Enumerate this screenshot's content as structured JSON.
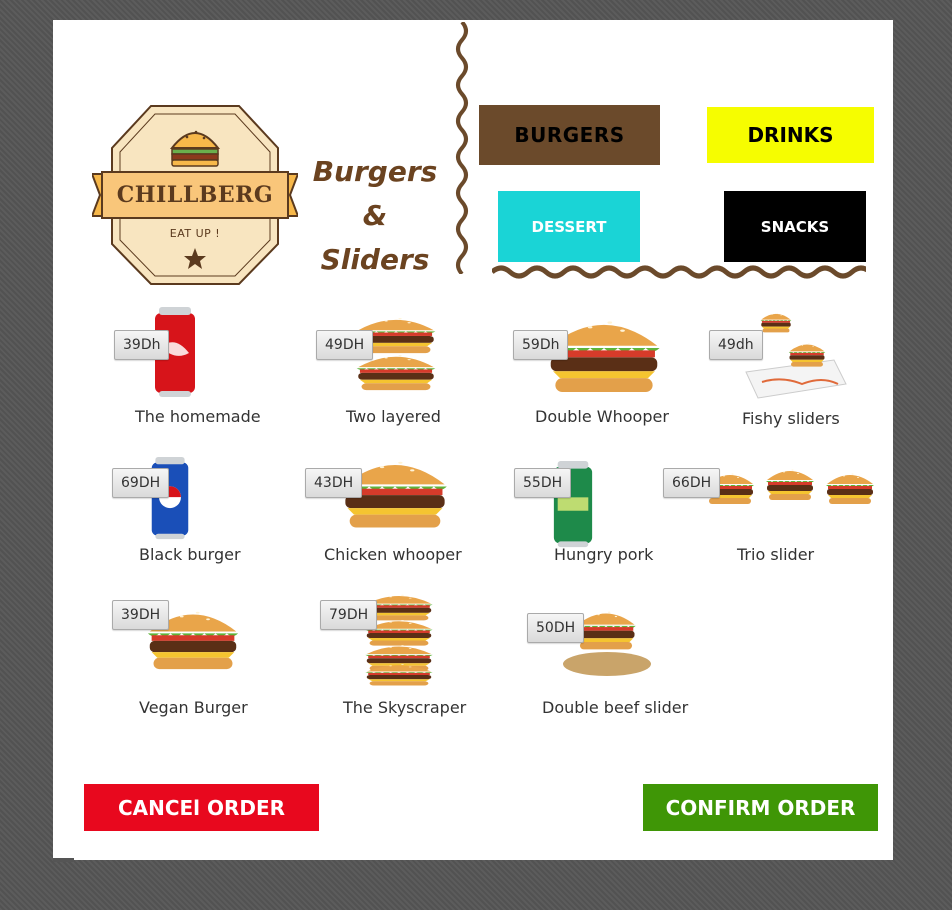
{
  "brand": {
    "name": "CHILLBERG",
    "tagline": "EAT UP !",
    "subtitle_line1": "Burgers &",
    "subtitle_line2": "Sliders"
  },
  "categories": [
    {
      "label": "BURGERS",
      "color": "#6b4a2b"
    },
    {
      "label": "DRINKS",
      "color": "#f6fd00"
    },
    {
      "label": "DESSERT",
      "color": "#1ad4d6"
    },
    {
      "label": "SNACKS",
      "color": "#000000"
    }
  ],
  "menu_items": [
    {
      "name": "The homemade",
      "price": "39Dh",
      "image": "cola-can"
    },
    {
      "name": "Two layered",
      "price": "49DH",
      "image": "burger"
    },
    {
      "name": "Double Whooper",
      "price": "59Dh",
      "image": "burger"
    },
    {
      "name": "Fishy sliders",
      "price": "49dh",
      "image": "sliders-plate"
    },
    {
      "name": "Black burger",
      "price": "69DH",
      "image": "pepsi-can"
    },
    {
      "name": "Chicken whooper",
      "price": "43DH",
      "image": "burger"
    },
    {
      "name": "Hungry pork",
      "price": "55DH",
      "image": "sprite-can"
    },
    {
      "name": "Trio slider",
      "price": "66DH",
      "image": "three-sliders"
    },
    {
      "name": "Vegan Burger",
      "price": "39DH",
      "image": "burger"
    },
    {
      "name": "The Skyscraper",
      "price": "79DH",
      "image": "tall-burger"
    },
    {
      "name": "Double beef slider",
      "price": "50DH",
      "image": "slider-board"
    }
  ],
  "actions": {
    "cancel_label": "CANCEl ORDER",
    "confirm_label": "CONFIRM ORDER",
    "cancel_color": "#e8081e",
    "confirm_color": "#3f9606"
  }
}
